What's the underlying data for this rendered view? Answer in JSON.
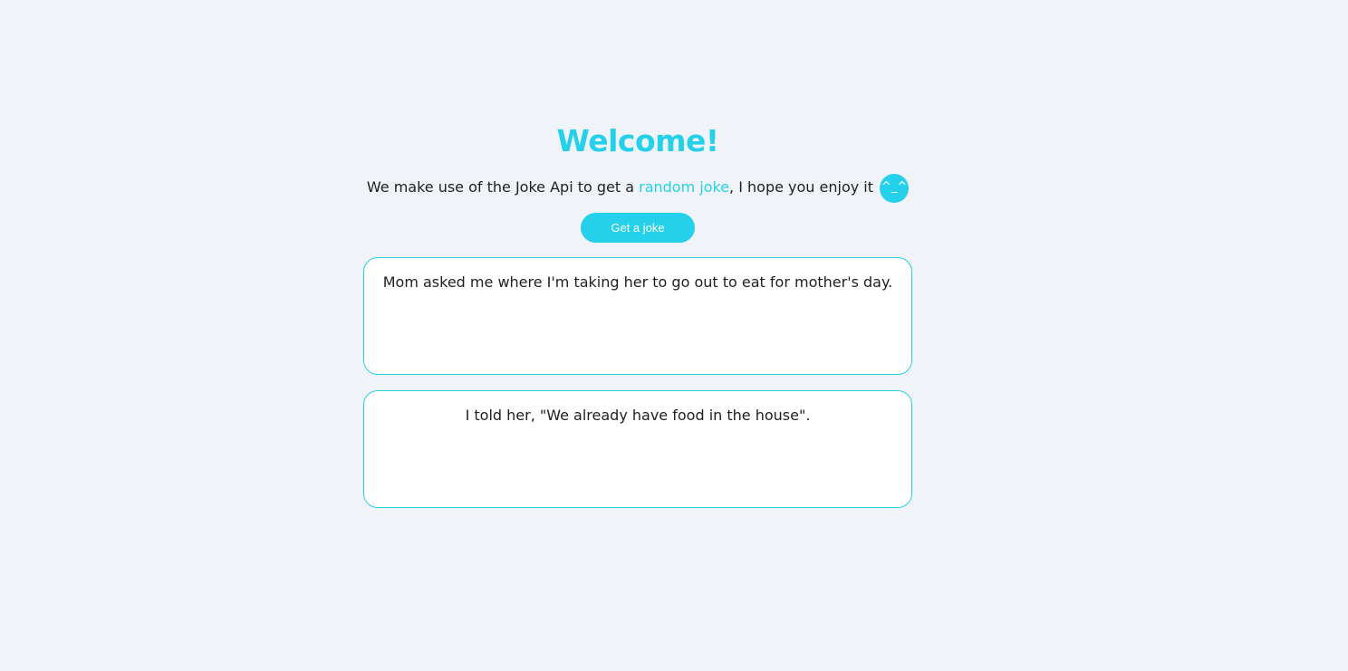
{
  "header": {
    "title": "Welcome!"
  },
  "intro": {
    "text_before": "We make use of the Joke Api to get a ",
    "link_text": "random joke",
    "text_after": ", I hope you enjoy it ",
    "emoticon": "^_^"
  },
  "actions": {
    "get_joke_label": "Get a joke"
  },
  "joke": {
    "setup": "Mom asked me where I'm taking her to go out to eat for mother's day.",
    "delivery": "I told her, \"We already have food in the house\"."
  },
  "colors": {
    "accent": "#25d0ea",
    "background": "#f0f4f9",
    "text": "#1f1f1f",
    "card": "#ffffff"
  }
}
